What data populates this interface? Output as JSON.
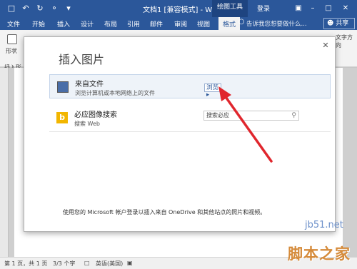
{
  "titlebar": {
    "doc_title": "文档1 [兼容模式] - Word",
    "context_tab": "绘图工具",
    "login": "登录",
    "icons": [
      "save-icon",
      "undo-icon",
      "redo-icon",
      "touch-mode-icon",
      "customize-icon"
    ],
    "window_icons": [
      "ribbon-display-icon",
      "minimize-icon",
      "maximize-icon",
      "close-icon"
    ]
  },
  "tabs": {
    "file": "文件",
    "home": "开始",
    "insert": "插入",
    "design": "设计",
    "layout": "布局",
    "references": "引用",
    "mailings": "邮件",
    "review": "审阅",
    "view": "视图",
    "format": "格式",
    "tell_me": "告诉我您想要做什么...",
    "share": "共享"
  },
  "ribbon": {
    "shape_label": "形状",
    "group_label": "插入形",
    "text_direction": "文字方向"
  },
  "statusbar": {
    "page": "第 1 页，共 1 页",
    "chars": "3/3 个字",
    "language": "英语(美国)"
  },
  "dialog": {
    "title": "插入图片",
    "from_file_title": "来自文件",
    "from_file_sub": "浏览计算机或本地网络上的文件",
    "browse_label": "浏览 ▸",
    "bing_title": "必应图像搜索",
    "bing_sub": "搜索 Web",
    "search_placeholder": "搜索必应",
    "footer": "使用您的 Microsoft 帐户登录以插入来自 OneDrive 和其他站点的照片和视频。"
  },
  "watermark": {
    "site": "jb51.net",
    "name": "脚本之家"
  },
  "colors": {
    "accent": "#2b579a",
    "annotation_arrow": "#e0262d",
    "bing_icon": "#f2b600"
  }
}
